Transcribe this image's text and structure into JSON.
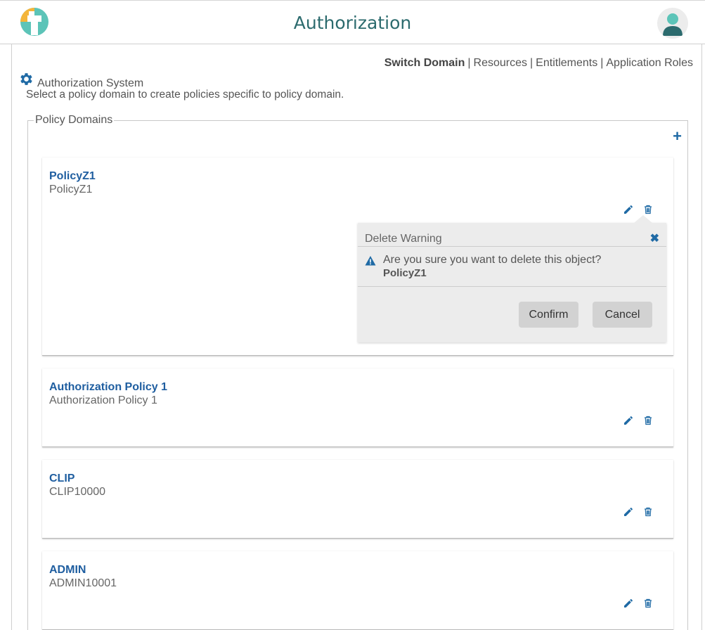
{
  "header": {
    "title": "Authorization",
    "logo_icon": "app-logo",
    "avatar_icon": "user-avatar-icon",
    "accent": "#2c6b6e"
  },
  "nav": {
    "items": [
      {
        "label": "Switch Domain",
        "active": true
      },
      {
        "label": "Resources",
        "active": false
      },
      {
        "label": "Entitlements",
        "active": false
      },
      {
        "label": "Application Roles",
        "active": false
      }
    ],
    "separator": "|"
  },
  "system": {
    "label": "Authorization System",
    "icon": "gear-icon",
    "description": "Select a policy domain to create policies specific to policy domain."
  },
  "domains": {
    "legend": "Policy Domains",
    "add_icon": "plus-icon",
    "add_symbol": "+",
    "items": [
      {
        "name": "PolicyZ1",
        "description": "PolicyZ1"
      },
      {
        "name": "Authorization Policy 1",
        "description": "Authorization Policy 1"
      },
      {
        "name": "CLIP",
        "description": "CLIP10000"
      },
      {
        "name": "ADMIN",
        "description": "ADMIN10001"
      }
    ]
  },
  "delete_warning": {
    "title": "Delete Warning",
    "close_symbol": "✖",
    "message": "Are you sure you want to delete this object?",
    "object_name": "PolicyZ1",
    "confirm_label": "Confirm",
    "cancel_label": "Cancel"
  },
  "colors": {
    "link_blue": "#1f5ea0",
    "icon_blue": "#1f6aa5",
    "popover_bg": "#ececec"
  }
}
